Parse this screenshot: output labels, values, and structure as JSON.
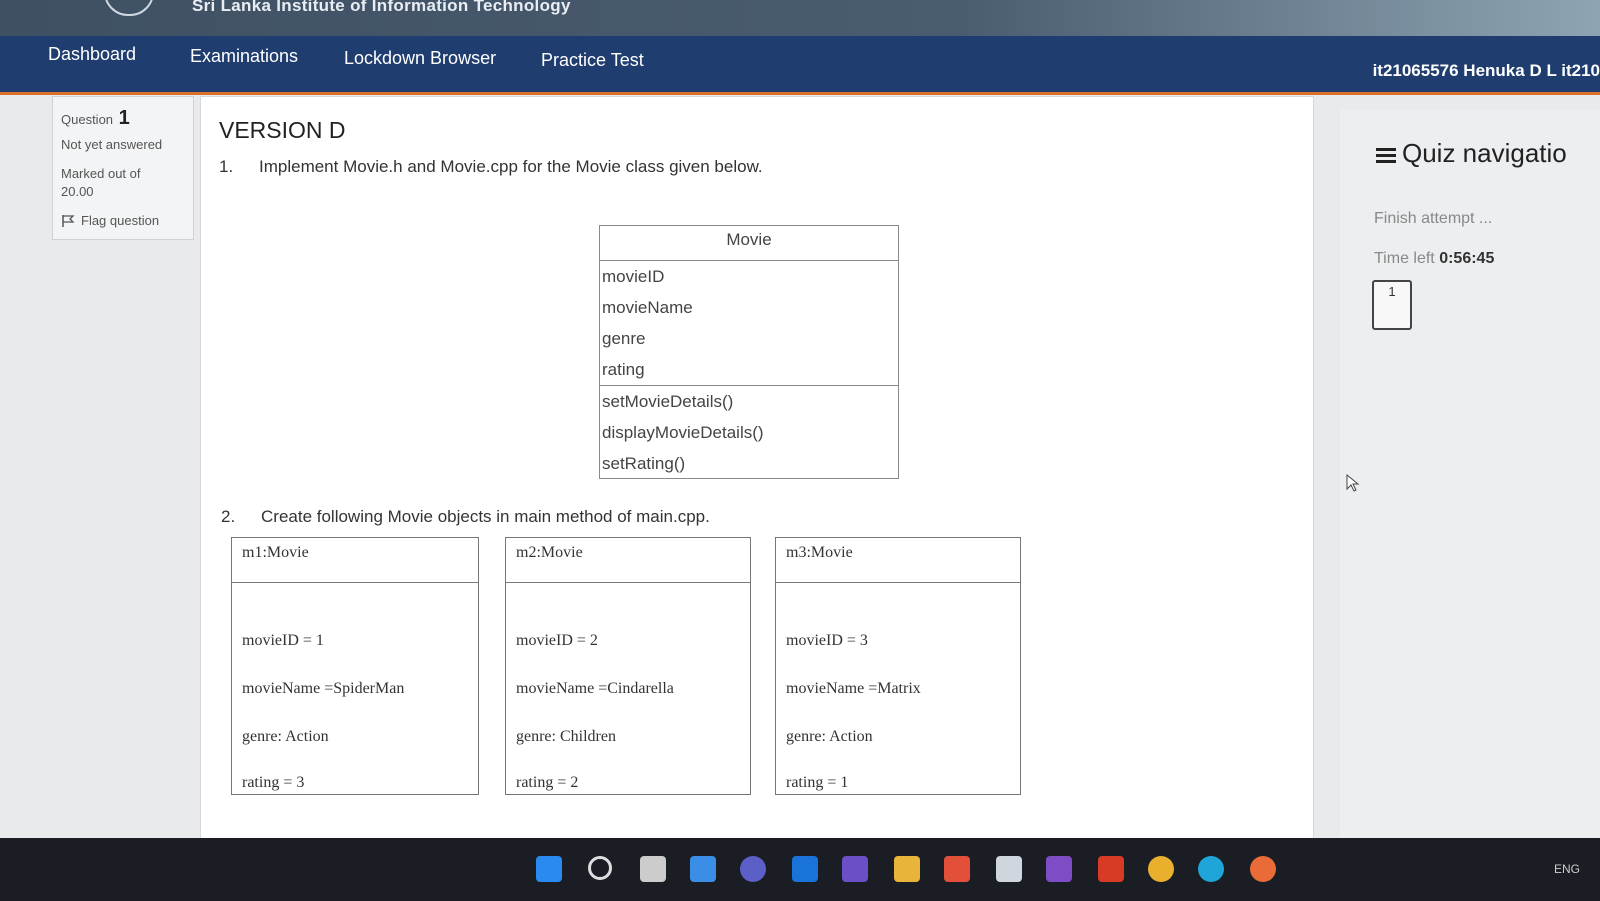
{
  "brand": {
    "institute": "Sri Lanka Institute of Information Technology"
  },
  "nav": {
    "items": [
      "Dashboard",
      "Examinations",
      "Lockdown Browser",
      "Practice Test"
    ],
    "user": "it21065576 Henuka D L it210"
  },
  "question_info": {
    "label": "Question",
    "number": "1",
    "status": "Not yet answered",
    "marked_label": "Marked out of",
    "marked_value": "20.00",
    "flag_label": "Flag question"
  },
  "content": {
    "version": "VERSION D",
    "q1_num": "1.",
    "q1_text": "Implement Movie.h and Movie.cpp for the Movie class given below.",
    "q2_num": "2.",
    "q2_text": "Create following Movie objects in main method of main.cpp."
  },
  "uml_class": {
    "name": "Movie",
    "attributes": [
      "movieID",
      "movieName",
      "genre",
      "rating"
    ],
    "methods": [
      "setMovieDetails()",
      "displayMovieDetails()",
      "setRating()"
    ]
  },
  "objects": [
    {
      "title": "m1:Movie",
      "id": "movieID = 1",
      "name": "movieName =SpiderMan",
      "genre": "genre: Action",
      "rating": "rating = 3"
    },
    {
      "title": "m2:Movie",
      "id": "movieID = 2",
      "name": "movieName =Cindarella",
      "genre": "genre: Children",
      "rating": "rating = 2"
    },
    {
      "title": "m3:Movie",
      "id": "movieID = 3",
      "name": "movieName =Matrix",
      "genre": "genre: Action",
      "rating": "rating = 1"
    }
  ],
  "quiz_nav": {
    "title": "Quiz navigatio",
    "finish": "Finish attempt ...",
    "time_label": "Time left",
    "time_value": "0:56:45",
    "question_button": "1"
  },
  "taskbar": {
    "icons": [
      "windows-start-icon",
      "search-icon",
      "task-view-icon",
      "widgets-icon",
      "chat-icon",
      "mail-icon",
      "visual-studio-code-icon",
      "file-explorer-icon",
      "xampp-icon",
      "notepad-icon",
      "visual-studio-icon",
      "office-icon",
      "chrome-icon",
      "edge-icon",
      "chrome-canary-icon"
    ],
    "language": "ENG"
  },
  "colors": {
    "navbar": "#1f3d6e",
    "accent": "#d9712a",
    "taskbar": "#1b1d24"
  }
}
